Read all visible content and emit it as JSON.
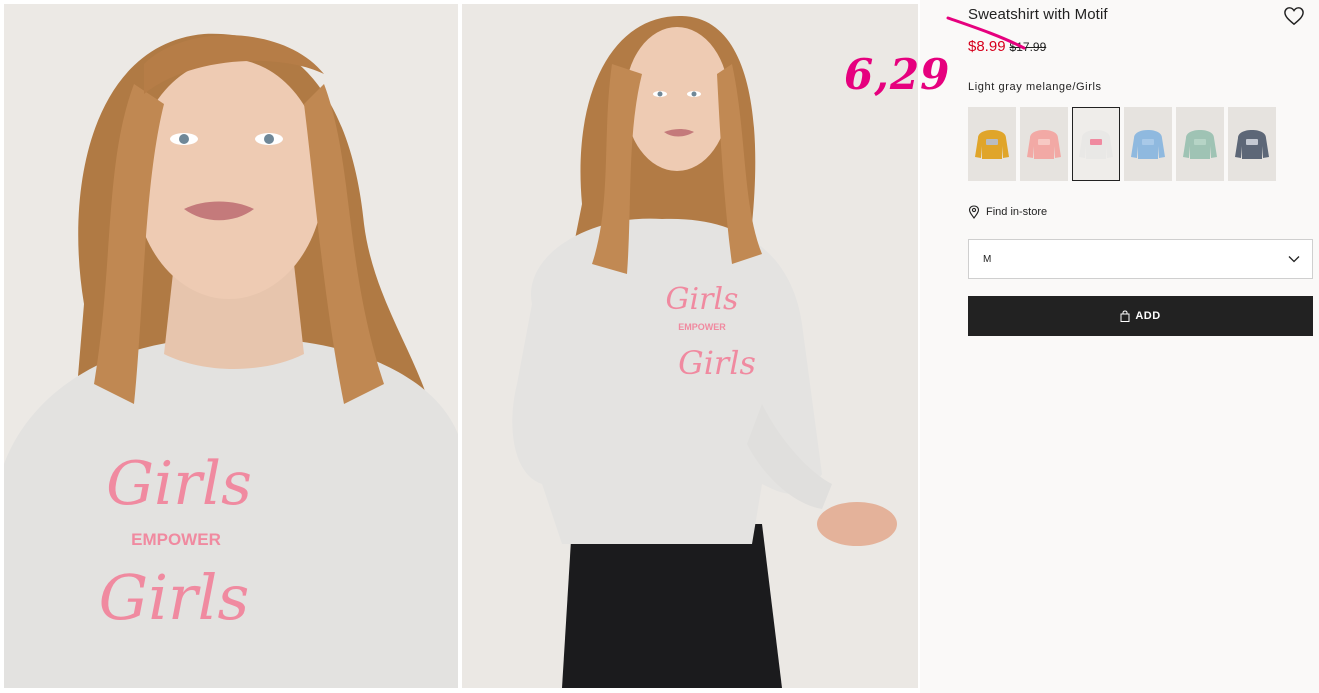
{
  "product": {
    "title": "Sweatshirt with Motif",
    "price_sale": "$8.99",
    "price_old": "$17.99",
    "color_name": "Light gray melange/Girls",
    "annotation_price": "6,29"
  },
  "gallery": {
    "print_line1": "Girls",
    "print_line2": "EMPOWER",
    "print_line3": "Girls"
  },
  "swatches": [
    {
      "name": "swatch-mustard-colorblock",
      "color": "#e0a52a",
      "accent": "#b9bcc2",
      "active": false
    },
    {
      "name": "swatch-pink",
      "color": "#f2a9a5",
      "accent": "#f7c9c4",
      "active": false
    },
    {
      "name": "swatch-light-gray-girls",
      "color": "#e9e8e6",
      "accent": "#f08aa0",
      "active": true
    },
    {
      "name": "swatch-light-blue",
      "color": "#8fb9df",
      "accent": "#a8c9e8",
      "active": false
    },
    {
      "name": "swatch-mint",
      "color": "#9fc3b4",
      "accent": "#b6d4c6",
      "active": false
    },
    {
      "name": "swatch-tie-dye",
      "color": "#5d6777",
      "accent": "#c4c9d2",
      "active": false
    }
  ],
  "store": {
    "label": "Find in-store",
    "icon": "location-pin-icon"
  },
  "size": {
    "value": "M"
  },
  "add": {
    "label": "ADD",
    "icon": "shopping-bag-icon"
  },
  "colors": {
    "accent_sale": "#d6001c",
    "annotation": "#e6007e",
    "button_bg": "#222222"
  }
}
